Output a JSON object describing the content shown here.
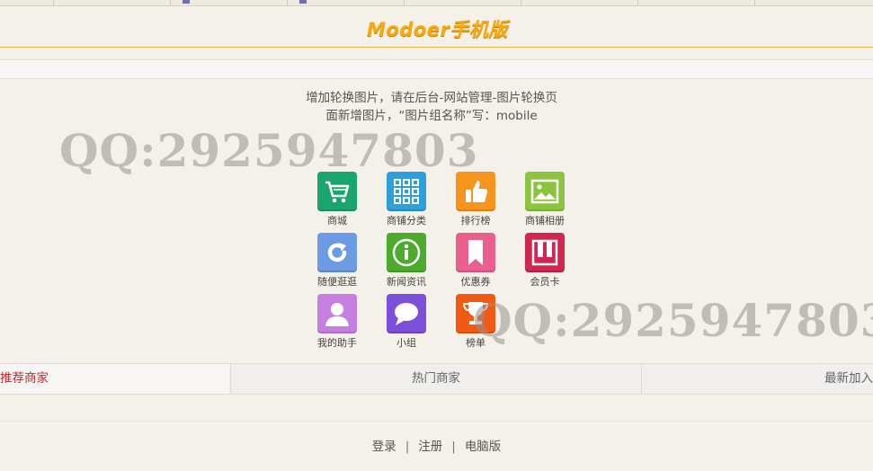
{
  "header": {
    "logo_text": "Modoer手机版"
  },
  "notice": {
    "line1": "增加轮换图片，请在后台-网站管理-图片轮换页",
    "line2": "面新增图片，“图片组名称”写：mobile"
  },
  "watermark": {
    "text": "QQ:2925947803"
  },
  "menu": [
    {
      "label": "商城",
      "icon": "shopping-cart-icon",
      "color": "#1aa46e"
    },
    {
      "label": "商铺分类",
      "icon": "grid-icon",
      "color": "#2e9fd9"
    },
    {
      "label": "排行榜",
      "icon": "thumbs-up-icon",
      "color": "#f7941d"
    },
    {
      "label": "商铺相册",
      "icon": "picture-icon",
      "color": "#8cc43f"
    },
    {
      "label": "随便逛逛",
      "icon": "refresh-icon",
      "color": "#6a9be3"
    },
    {
      "label": "新闻资讯",
      "icon": "info-icon",
      "color": "#4caa2c"
    },
    {
      "label": "优惠券",
      "icon": "bookmark-icon",
      "color": "#e9608f"
    },
    {
      "label": "会员卡",
      "icon": "card-icon",
      "color": "#d0264f"
    },
    {
      "label": "我的助手",
      "icon": "user-icon",
      "color": "#c57fe0"
    },
    {
      "label": "小组",
      "icon": "chat-bubble-icon",
      "color": "#7b4fd8"
    },
    {
      "label": "榜单",
      "icon": "trophy-icon",
      "color": "#f05a12"
    }
  ],
  "tabs": {
    "recommended": "推荐商家",
    "popular": "热门商家",
    "newest": "最新加入"
  },
  "footer": {
    "login": "登录",
    "register": "注册",
    "desktop": "电脑版",
    "separator": "|"
  }
}
